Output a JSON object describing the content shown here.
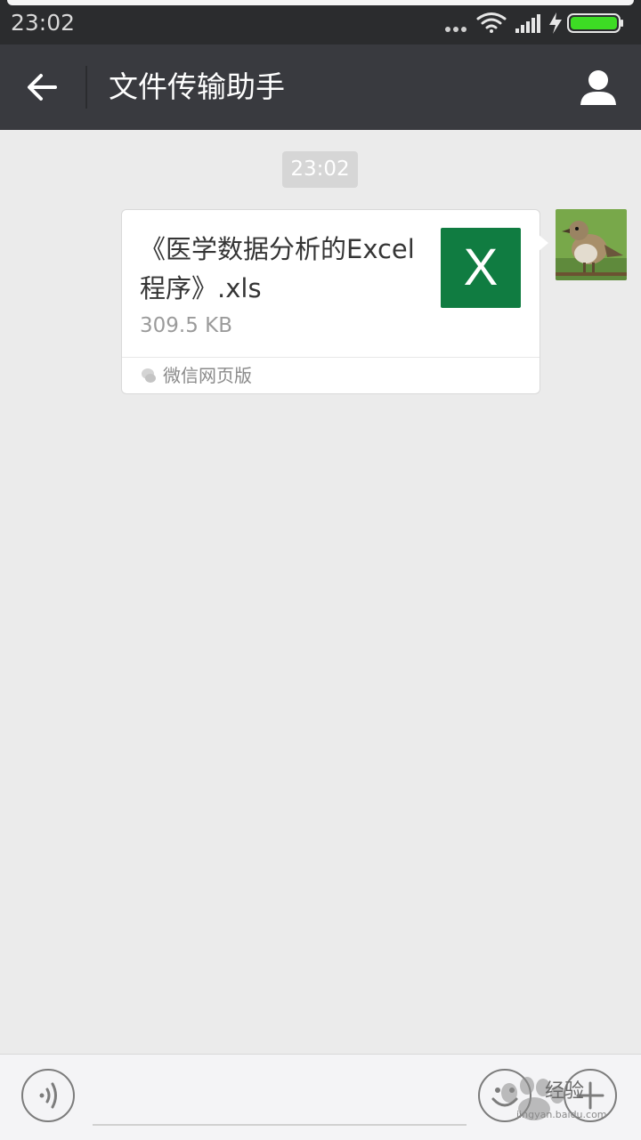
{
  "status_bar": {
    "time": "23:02",
    "icons": [
      "more-dots-icon",
      "wifi-icon",
      "cell-signal-icon",
      "charging-icon",
      "battery-icon"
    ],
    "battery_color": "#3ddc24"
  },
  "header": {
    "title": "文件传输助手",
    "back_icon": "back-arrow-icon",
    "profile_icon": "person-icon",
    "background": "#393a3f"
  },
  "chat": {
    "timestamp": "23:02",
    "messages": [
      {
        "type": "file",
        "sender": "self",
        "file_name": "《医学数据分析的Excel程序》.xls",
        "file_size": "309.5 KB",
        "file_icon": "excel-icon",
        "file_icon_letter": "X",
        "file_icon_color": "#107c41",
        "source": "微信网页版"
      }
    ]
  },
  "input_bar": {
    "voice_icon": "voice-icon",
    "emoji_icon": "emoji-icon",
    "plus_icon": "plus-icon",
    "input_value": ""
  },
  "watermark": {
    "text": "经验",
    "url": "jingyan.baidu.com"
  }
}
